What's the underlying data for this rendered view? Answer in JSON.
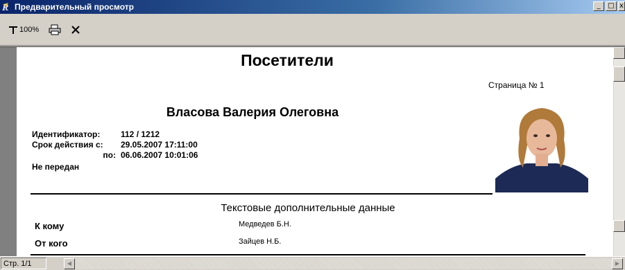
{
  "window": {
    "title": "Предварительный просмотр",
    "buttons": [
      "_",
      "□",
      "x"
    ]
  },
  "toolbar": {
    "zoom_label": "100%"
  },
  "report": {
    "title": "Посетители",
    "page_label": "Страница № 1",
    "person_name": "Власова Валерия Олеговна",
    "id_label": "Идентификатор:",
    "id_value": "112 / 1212",
    "valid_from_label": "Срок действия с:",
    "valid_from_value": "29.05.2007 17:11:00",
    "valid_to_label": "по:",
    "valid_to_value": "06.06.2007 10:01:06",
    "status": "Не передан",
    "section_title": "Текстовые дополнительные данные",
    "fields": [
      {
        "label": "К кому",
        "value": "Медведев Б.Н."
      },
      {
        "label": "От кого",
        "value": "Зайцев Н.Б."
      }
    ]
  },
  "status": {
    "page": "Стр. 1/1"
  }
}
